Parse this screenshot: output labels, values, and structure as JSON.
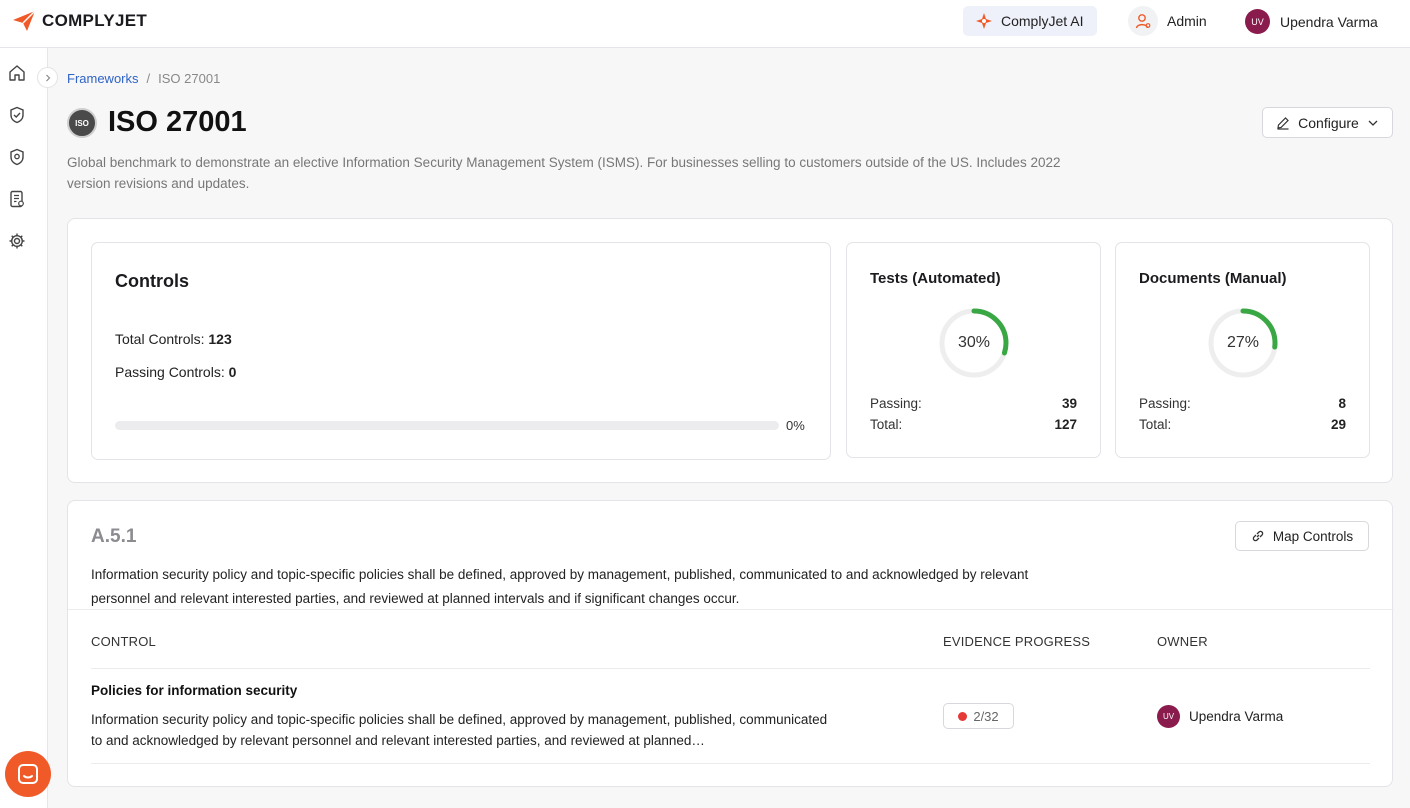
{
  "brand": {
    "name": "COMPLYJET",
    "accent": "#f05a28"
  },
  "header": {
    "ai_label": "ComplyJet AI",
    "admin_label": "Admin",
    "user_initials": "UV",
    "user_name": "Upendra Varma"
  },
  "sidebar": {
    "items": [
      {
        "icon": "home-icon"
      },
      {
        "icon": "shield-check-icon"
      },
      {
        "icon": "shield-icon"
      },
      {
        "icon": "report-icon"
      },
      {
        "icon": "gear-icon"
      }
    ]
  },
  "breadcrumb": {
    "parent": "Frameworks",
    "separator": "/",
    "current": "ISO 27001"
  },
  "framework": {
    "badge": "ISO",
    "title": "ISO 27001",
    "configure_label": "Configure",
    "description": "Global benchmark to demonstrate an elective Information Security Management System (ISMS). For businesses selling to customers outside of the US. Includes 2022 version revisions and updates."
  },
  "controls_card": {
    "title": "Controls",
    "total_label": "Total Controls:",
    "total_value": "123",
    "passing_label": "Passing Controls:",
    "passing_value": "0",
    "progress_text": "0%",
    "progress_fraction": 0
  },
  "tests_card": {
    "title": "Tests (Automated)",
    "percent_text": "30%",
    "percent_fraction": 0.3,
    "passing_label": "Passing:",
    "passing_value": "39",
    "total_label": "Total:",
    "total_value": "127"
  },
  "documents_card": {
    "title": "Documents (Manual)",
    "percent_text": "27%",
    "percent_fraction": 0.27,
    "passing_label": "Passing:",
    "passing_value": "8",
    "total_label": "Total:",
    "total_value": "29"
  },
  "section": {
    "id": "A.5.1",
    "map_label": "Map Controls",
    "description": "Information security policy and topic-specific policies shall be defined, approved by management, published, communicated to and acknowledged by relevant personnel and relevant interested parties, and reviewed at planned intervals and if significant changes occur.",
    "columns": [
      "CONTROL",
      "EVIDENCE PROGRESS",
      "OWNER"
    ],
    "rows": [
      {
        "title": "Policies for information security",
        "description": "Information security policy and topic-specific policies shall be defined, approved by management, published, communicated to and acknowledged by relevant personnel and relevant interested parties, and reviewed at planned…",
        "evidence": "2/32",
        "owner_initials": "UV",
        "owner_name": "Upendra Varma"
      }
    ]
  },
  "colors": {
    "ring_progress": "#3aa745",
    "ring_track": "#eeeeee",
    "status_red": "#e53935",
    "avatar": "#8a1b4d",
    "link": "#2f63c6"
  }
}
